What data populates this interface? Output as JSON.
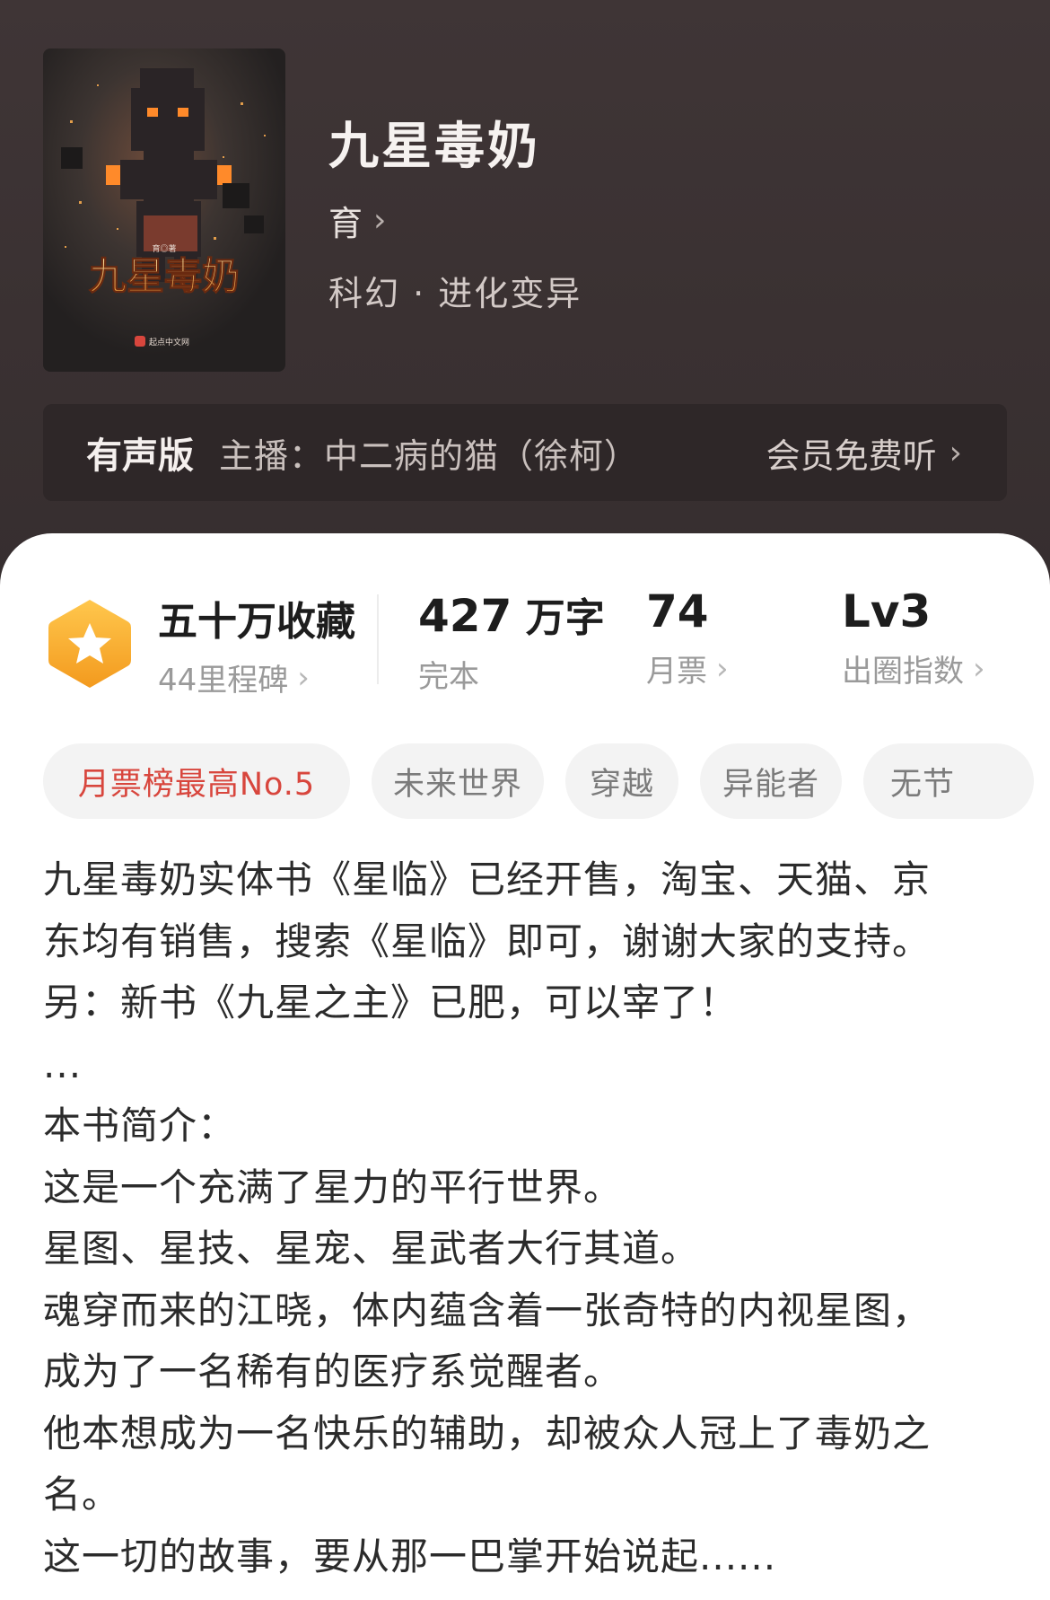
{
  "book": {
    "title": "九星毒奶",
    "author": "育",
    "genre": "科幻 · 进化变异",
    "cover": {
      "title_text": "九星毒奶",
      "author_text": "育◎著",
      "publisher_text": "起点中文网"
    }
  },
  "audio": {
    "tag": "有声版",
    "host": "主播：中二病的猫（徐柯）",
    "cta": "会员免费听"
  },
  "stats": {
    "collection_value": "五十万收藏",
    "collection_label": "44里程碑",
    "words_number": "427",
    "words_unit": "万字",
    "words_label": "完本",
    "monthly_value": "74",
    "monthly_label": "月票",
    "level_value": "Lv3",
    "level_label": "出圈指数"
  },
  "tags": [
    "月票榜最高No.5",
    "未来世界",
    "穿越",
    "异能者",
    "无节"
  ],
  "description": {
    "lines": [
      "九星毒奶实体书《星临》已经开售，淘宝、天猫、京",
      "东均有销售，搜索《星临》即可，谢谢大家的支持。",
      "另：新书《九星之主》已肥，可以宰了！",
      "...",
      "本书简介：",
      "这是一个充满了星力的平行世界。",
      "星图、星技、星宠、星武者大行其道。",
      "魂穿而来的江晓，体内蕴含着一张奇特的内视星图，",
      "成为了一名稀有的医疗系觉醒者。",
      "他本想成为一名快乐的辅助，却被众人冠上了毒奶之",
      "名。",
      "这一切的故事，要从那一巴掌开始说起......"
    ]
  },
  "colors": {
    "hero_bg": "#3a3132",
    "audio_bar_bg": "#2e2728",
    "accent_red": "#d8463d",
    "badge_orange": "#f5a623"
  },
  "icons": {
    "chevron": "chevron-right-icon",
    "badge": "star-hexagon-icon"
  }
}
